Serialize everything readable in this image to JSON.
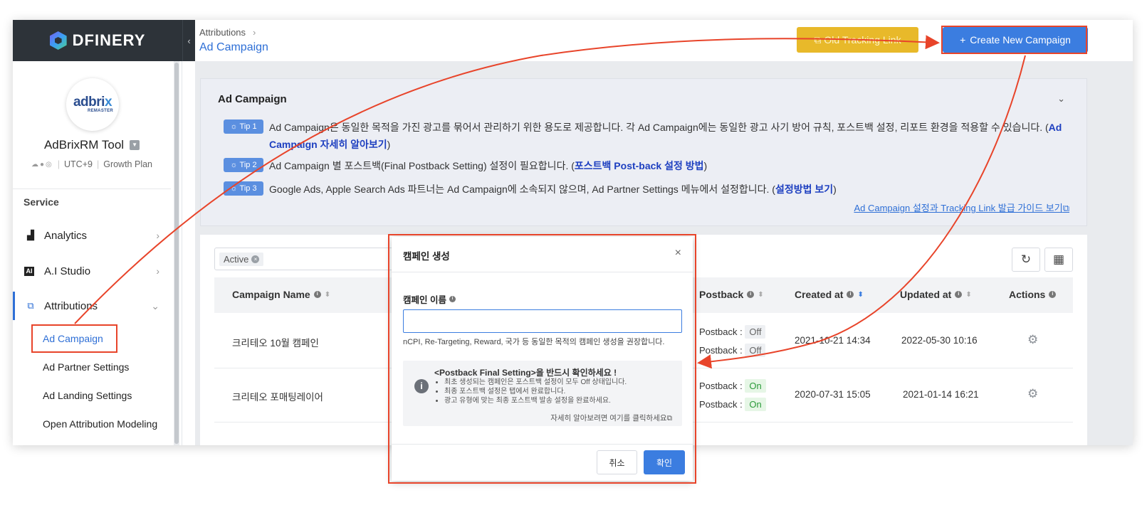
{
  "colors": {
    "accent": "#3b7de0",
    "old_button": "#e8b92a",
    "annotation": "#e8442a",
    "sidebar_dark": "#2d3339"
  },
  "brand": {
    "logo_text": "DFINERY"
  },
  "profile": {
    "logo_main": "adbri",
    "logo_accent": "x",
    "logo_sub": "REMASTER",
    "app_name": "AdBrixRM Tool",
    "timezone": "UTC+9",
    "plan": "Growth Plan"
  },
  "sidebar": {
    "section": "Service",
    "items": [
      {
        "label": "Analytics",
        "icon": "bar-chart-icon"
      },
      {
        "label": "A.I Studio",
        "icon": "ai-icon"
      },
      {
        "label": "Attributions",
        "icon": "attribution-icon"
      }
    ],
    "sub_items": [
      {
        "label": "Ad Campaign"
      },
      {
        "label": "Ad Partner Settings"
      },
      {
        "label": "Ad Landing Settings"
      },
      {
        "label": "Open Attribution Modeling"
      }
    ]
  },
  "header": {
    "breadcrumb": "Attributions",
    "title": "Ad Campaign",
    "old_link_label": "Old Tracking Link",
    "new_campaign_label": "Create New Campaign"
  },
  "info": {
    "title": "Ad Campaign",
    "tips": [
      {
        "badge": "Tip 1",
        "text": "Ad Campaign은 동일한 목적을 가진 광고를 묶어서 관리하기 위한 용도로 제공합니다. 각 Ad Campaign에는 동일한 광고 사기 방어 규칙, 포스트백 설정, 리포트 환경을 적용할 수 있습니다. (",
        "link": "Ad Campaign 자세히 알아보기",
        "tail": ")"
      },
      {
        "badge": "Tip 2",
        "text": "Ad Campaign 별 포스트백(Final Postback Setting) 설정이 필요합니다. (",
        "link": "포스트백 Post-back 설정 방법",
        "tail": ")"
      },
      {
        "badge": "Tip 3",
        "text": "Google Ads, Apple Search Ads 파트너는 Ad Campaign에 소속되지 않으며, Ad Partner Settings 메뉴에서 설정합니다. (",
        "link": "설정방법 보기",
        "tail": ")"
      }
    ],
    "guide_link": "Ad Campaign 설정과 Tracking Link 발급 가이드 보기"
  },
  "table": {
    "filter_chip": "Active",
    "columns": {
      "name": "Campaign Name",
      "postback": "Postback",
      "created": "Created at",
      "updated": "Updated at",
      "actions": "Actions"
    },
    "postback_prefix": "Postback :",
    "rows": [
      {
        "name": "크리테오 10월 캠페인",
        "pb1": "Off",
        "pb2": "Off",
        "created": "2021-10-21 14:34",
        "updated": "2022-05-30 10:16"
      },
      {
        "name": "크리테오 포매팅레이어",
        "pb1": "On",
        "pb2": "On",
        "created": "2020-07-31 15:05",
        "updated": "2021-01-14 16:21"
      }
    ]
  },
  "modal": {
    "title": "캠페인 생성",
    "field_label": "캠페인 이름",
    "input_value": "",
    "hint": "nCPI, Re-Targeting, Reward, 국가 등 동일한 목적의 캠페인 생성을 권장합니다.",
    "notice_title": "<Postback Final Setting>을 반드시 확인하세요 !",
    "notice_items": [
      "최초 생성되는 캠페인은 포스트백 설정이 모두 Off 상태입니다.",
      "최종 포스트백 설정은 탭에서 완료합니다.",
      "광고 유형에 맞는 최종 포스트백 발송 설정을 완료하세요."
    ],
    "notice_more": "자세히 알아보려면 여기를 클릭하세요",
    "cancel_label": "취소",
    "ok_label": "확인"
  }
}
